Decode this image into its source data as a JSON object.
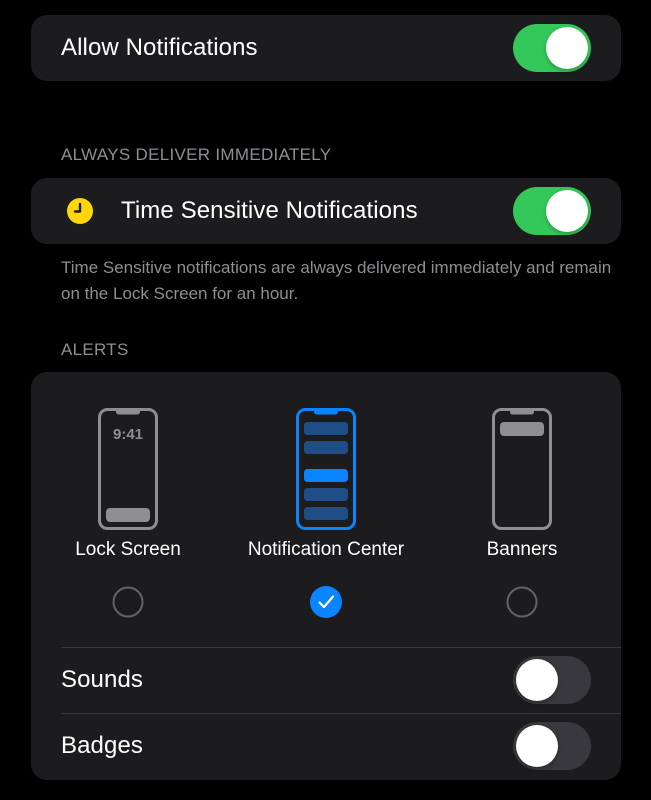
{
  "allow_notifications": {
    "label": "Allow Notifications",
    "enabled": true
  },
  "always_deliver": {
    "header": "ALWAYS DELIVER IMMEDIATELY",
    "time_sensitive": {
      "label": "Time Sensitive Notifications",
      "enabled": true,
      "icon": "clock-icon"
    },
    "footnote": "Time Sensitive notifications are always delivered immediately and remain on the Lock Screen for an hour."
  },
  "alerts": {
    "header": "ALERTS",
    "options": [
      {
        "label": "Lock Screen",
        "selected": false,
        "time": "9:41"
      },
      {
        "label": "Notification Center",
        "selected": true
      },
      {
        "label": "Banners",
        "selected": false
      }
    ],
    "sounds": {
      "label": "Sounds",
      "enabled": false
    },
    "badges": {
      "label": "Badges",
      "enabled": false
    }
  },
  "colors": {
    "toggle_on": "#34c759",
    "toggle_off": "#39393d",
    "accent_blue": "#0a84ff",
    "clock_yellow": "#ffd60a",
    "card_bg": "#1c1c1e",
    "secondary_text": "#8e8e93"
  }
}
